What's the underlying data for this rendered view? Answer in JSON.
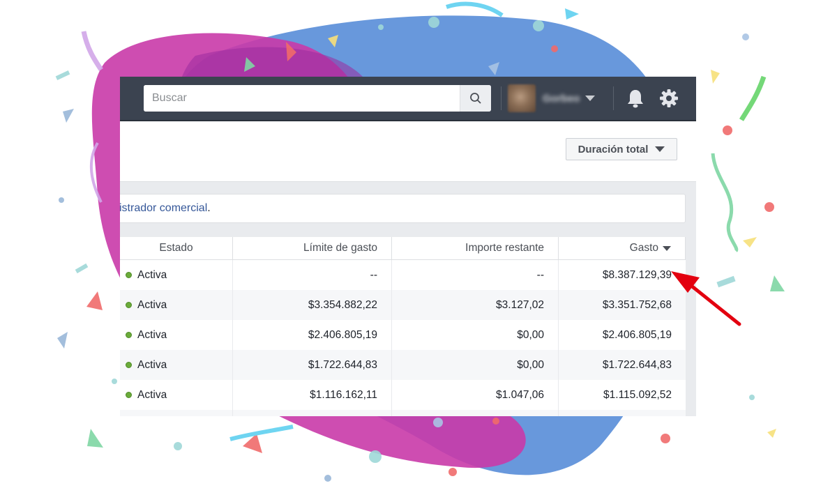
{
  "search": {
    "placeholder": "Buscar",
    "icon": "search-icon"
  },
  "profile": {
    "username": "Gorbeo",
    "avatar_icon": "avatar"
  },
  "header_icons": [
    "bell-icon",
    "gear-icon"
  ],
  "toolbar": {
    "date_range_label": "Duración total"
  },
  "notice": {
    "text": "istrador comercial",
    "punct": "."
  },
  "table": {
    "columns": [
      "Estado",
      "Límite de gasto",
      "Importe restante",
      "Gasto"
    ],
    "sorted_column": "Gasto",
    "rows": [
      {
        "status": "Activa",
        "limit": "--",
        "remaining": "--",
        "spend": "$8.387.129,39"
      },
      {
        "status": "Activa",
        "limit": "$3.354.882,22",
        "remaining": "$3.127,02",
        "spend": "$3.351.752,68"
      },
      {
        "status": "Activa",
        "limit": "$2.406.805,19",
        "remaining": "$0,00",
        "spend": "$2.406.805,19"
      },
      {
        "status": "Activa",
        "limit": "$1.722.644,83",
        "remaining": "$0,00",
        "spend": "$1.722.644,83"
      },
      {
        "status": "Activa",
        "limit": "$1.116.162,11",
        "remaining": "$1.047,06",
        "spend": "$1.115.092,52"
      }
    ]
  },
  "colors": {
    "topbar": "#3b4350",
    "link": "#365899",
    "status_active": "#6bab3a",
    "arrow": "#e3000f",
    "blob_blue": "#5b8fd9",
    "blob_magenta": "#c93aa8"
  }
}
